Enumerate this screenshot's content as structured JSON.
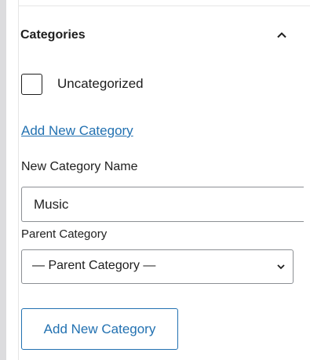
{
  "panel": {
    "title": "Categories"
  },
  "categories": {
    "items": [
      {
        "label": "Uncategorized",
        "checked": false
      }
    ]
  },
  "add_category": {
    "toggle_link": "Add New Category",
    "name_label": "New Category Name",
    "name_value": "Music",
    "parent_label": "Parent Category",
    "parent_selected": "— Parent Category —",
    "submit_label": "Add New Category"
  },
  "icons": {
    "collapse": "chevron-up-icon",
    "select_arrow": "chevron-down-icon"
  },
  "colors": {
    "link": "#2271b1",
    "text": "#1e1e1e",
    "border": "#8c8f94"
  }
}
